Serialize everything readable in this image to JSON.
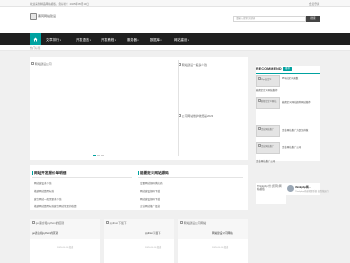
{
  "top_bar": {
    "left_text": "欢迎来到精品网站模板，您好的！  2025年05月10日",
    "right_link": "会员登录"
  },
  "header": {
    "logo_alt": "黑冈网站建设"
  },
  "search": {
    "placeholder": "请输入搜索关键词",
    "button_label": "搜索"
  },
  "nav": {
    "items": [
      "文章排行",
      "开发语言",
      "开发教程",
      "服务器",
      "数据库",
      "网站建设"
    ]
  },
  "breadcrumb": "热门标签",
  "slider": {
    "img1_alt": "网站建设公司",
    "img2_alt": "网站建设一般多少钱",
    "img3_alt": "网站建设公司推荐",
    "img4_alt": "公司网站维护收费是2023"
  },
  "recommend": {
    "title": "RECOMMEND",
    "badge": "推荐",
    "items": [
      {
        "thumb_alt": "Php自定义",
        "text": "Php自定义函数"
      },
      {
        "text": "能帮定定义网站推荐"
      },
      {
        "thumb_alt": "能帮定定义网站",
        "text": "能帮定义网站推荐网站推荐"
      },
      {
        "thumb_alt": "企业网站推广",
        "text": "企业网站推广方案怎样做"
      },
      {
        "thumb_alt": "企业网站推广",
        "text": "企业网站推广公司"
      },
      {
        "text": "企业网站推广公司"
      }
    ]
  },
  "qr": {
    "alt": "Thinkphp 仿 [黑冈] 网站模板"
  },
  "user": {
    "name": "thinkphp网...",
    "desc": "Thinkphp内容管理系统 高性能运行"
  },
  "topics": [
    {
      "title": "网站开发报价单明细",
      "links": [
        "网站建设多少钱",
        "搭建网站费用标准",
        "建立网站一般需要多少钱",
        "搭建网站费用标准建立网站常见的收费"
      ]
    },
    {
      "title": "能要定义网站源码",
      "links": [
        "定量网站源码供应商",
        "网站建设源码下载",
        "网站建设源码下载",
        "企业网站推广渠道"
      ]
    }
  ],
  "cards": [
    {
      "img_alt": "go语言和python的区别",
      "title": "go语言和python的区别",
      "meta": "2025-05-10  阅读"
    },
    {
      "img_alt": "python下载下",
      "title": "python下载下",
      "meta": "2025-05-10  阅读"
    },
    {
      "img_alt": "网站建设公司网站",
      "title": "网站建设公司网站",
      "meta": "2025-05-10  阅读"
    }
  ],
  "colors": {
    "accent": "#00a2a0",
    "nav_bg": "#1f1f1f"
  }
}
